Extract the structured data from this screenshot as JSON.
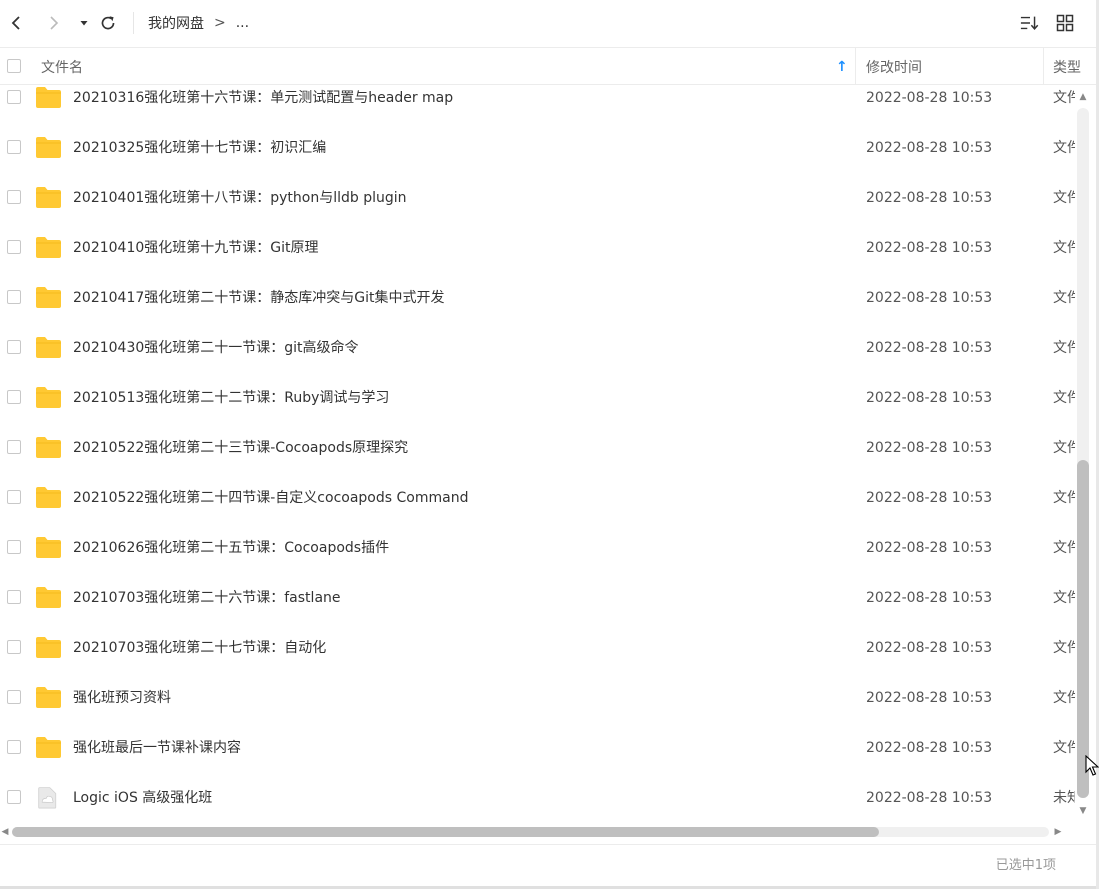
{
  "toolbar": {
    "back_icon": "chevron-left-icon",
    "forward_icon": "chevron-right-icon",
    "history_icon": "caret-down-icon",
    "refresh_icon": "refresh-icon",
    "breadcrumb": {
      "root": "我的网盘",
      "separator": ">",
      "more": "..."
    },
    "sort_icon": "sort-list-icon",
    "view_icon": "grid-view-icon"
  },
  "header": {
    "name_label": "文件名",
    "sort_arrow": "↑",
    "modified_label": "修改时间",
    "type_label": "类型"
  },
  "files": [
    {
      "name": "20210316强化班第十六节课：单元测试配置与header map",
      "modified": "2022-08-28 10:53",
      "type": "文件夹",
      "icon": "folder-icon"
    },
    {
      "name": "20210325强化班第十七节课：初识汇编",
      "modified": "2022-08-28 10:53",
      "type": "文件夹",
      "icon": "folder-icon"
    },
    {
      "name": "20210401强化班第十八节课：python与lldb plugin",
      "modified": "2022-08-28 10:53",
      "type": "文件夹",
      "icon": "folder-icon"
    },
    {
      "name": "20210410强化班第十九节课：Git原理",
      "modified": "2022-08-28 10:53",
      "type": "文件夹",
      "icon": "folder-icon"
    },
    {
      "name": "20210417强化班第二十节课：静态库冲突与Git集中式开发",
      "modified": "2022-08-28 10:53",
      "type": "文件夹",
      "icon": "folder-icon"
    },
    {
      "name": "20210430强化班第二十一节课：git高级命令",
      "modified": "2022-08-28 10:53",
      "type": "文件夹",
      "icon": "folder-icon"
    },
    {
      "name": "20210513强化班第二十二节课：Ruby调试与学习",
      "modified": "2022-08-28 10:53",
      "type": "文件夹",
      "icon": "folder-icon"
    },
    {
      "name": "20210522强化班第二十三节课-Cocoapods原理探究",
      "modified": "2022-08-28 10:53",
      "type": "文件夹",
      "icon": "folder-icon"
    },
    {
      "name": "20210522强化班第二十四节课-自定义cocoapods Command",
      "modified": "2022-08-28 10:53",
      "type": "文件夹",
      "icon": "folder-icon"
    },
    {
      "name": "20210626强化班第二十五节课：Cocoapods插件",
      "modified": "2022-08-28 10:53",
      "type": "文件夹",
      "icon": "folder-icon"
    },
    {
      "name": "20210703强化班第二十六节课：fastlane",
      "modified": "2022-08-28 10:53",
      "type": "文件夹",
      "icon": "folder-icon"
    },
    {
      "name": "20210703强化班第二十七节课：自动化",
      "modified": "2022-08-28 10:53",
      "type": "文件夹",
      "icon": "folder-icon"
    },
    {
      "name": "强化班预习资料",
      "modified": "2022-08-28 10:53",
      "type": "文件夹",
      "icon": "folder-icon"
    },
    {
      "name": "强化班最后一节课补课内容",
      "modified": "2022-08-28 10:53",
      "type": "文件夹",
      "icon": "folder-icon"
    },
    {
      "name": "Logic iOS 高级强化班",
      "modified": "2022-08-28 10:53",
      "type": "未知",
      "icon": "unknown-file-icon"
    }
  ],
  "status": {
    "selected_text": "已选中1项"
  },
  "colors": {
    "folder": "#FFC933",
    "accent": "#1E90FF",
    "scroll_thumb": "#BFBFBF"
  }
}
